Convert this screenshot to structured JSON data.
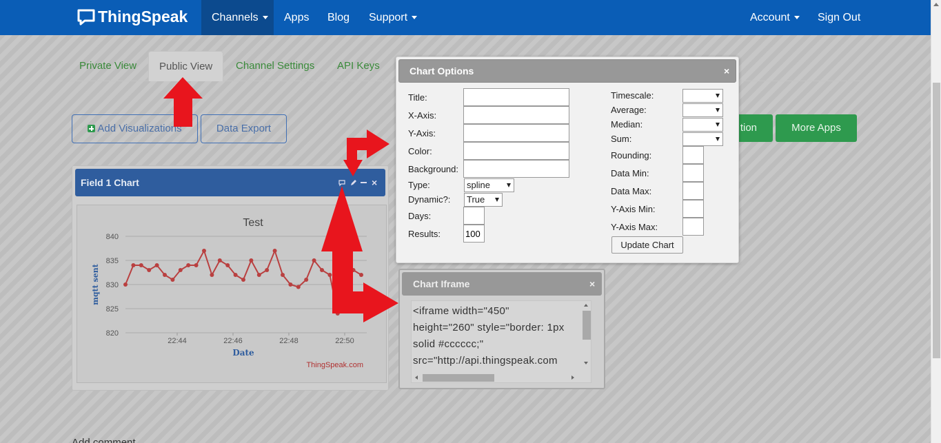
{
  "navbar": {
    "brand": "ThingSpeak",
    "items": [
      {
        "label": "Channels",
        "dropdown": true,
        "active": true
      },
      {
        "label": "Apps"
      },
      {
        "label": "Blog"
      },
      {
        "label": "Support",
        "dropdown": true
      }
    ],
    "right_items": [
      {
        "label": "Account",
        "dropdown": true
      },
      {
        "label": "Sign Out"
      }
    ],
    "bg_color": "#0a5db6"
  },
  "tabs": [
    {
      "label": "Private View"
    },
    {
      "label": "Public View",
      "active": true
    },
    {
      "label": "Channel Settings"
    },
    {
      "label": "API Keys"
    }
  ],
  "buttons": {
    "add_visualizations": "Add Visualizations",
    "data_export": "Data Export",
    "partial_app_button": "tion",
    "more_apps": "More Apps"
  },
  "field_chart": {
    "panel_title": "Field 1 Chart",
    "icons": [
      "comment-icon",
      "pencil-icon",
      "minimize-icon",
      "close-icon"
    ],
    "credit": "ThingSpeak.com"
  },
  "chart_data": {
    "type": "line",
    "title": "Test",
    "xlabel": "Date",
    "ylabel": "mqtt sent",
    "y_ticks": [
      "840",
      "835",
      "830",
      "825",
      "820"
    ],
    "x_ticks": [
      "22:44",
      "22:46",
      "22:48",
      "22:50"
    ],
    "ylim": [
      820,
      840
    ],
    "series_color": "#b94040",
    "series": [
      {
        "values": [
          830,
          834,
          834,
          833,
          834,
          832,
          831,
          833,
          834,
          834,
          837,
          832,
          835,
          834,
          832,
          831,
          835,
          832,
          833,
          837,
          832,
          830,
          829.5,
          831,
          835,
          833,
          832,
          824,
          833,
          833,
          832
        ]
      }
    ]
  },
  "chart_options": {
    "title": "Chart Options",
    "left_fields": [
      {
        "label": "Title:",
        "value": ""
      },
      {
        "label": "X-Axis:",
        "value": ""
      },
      {
        "label": "Y-Axis:",
        "value": ""
      },
      {
        "label": "Color:",
        "value": ""
      },
      {
        "label": "Background:",
        "value": ""
      }
    ],
    "type_label": "Type:",
    "type_value": "spline",
    "dynamic_label": "Dynamic?:",
    "dynamic_value": "True",
    "days_label": "Days:",
    "days_value": "",
    "results_label": "Results:",
    "results_value": "100",
    "right_selects": [
      {
        "label": "Timescale:",
        "value": ""
      },
      {
        "label": "Average:",
        "value": ""
      },
      {
        "label": "Median:",
        "value": ""
      },
      {
        "label": "Sum:",
        "value": ""
      }
    ],
    "right_fields": [
      {
        "label": "Rounding:",
        "value": ""
      },
      {
        "label": "Data Min:",
        "value": ""
      },
      {
        "label": "Data Max:",
        "value": ""
      },
      {
        "label": "Y-Axis Min:",
        "value": ""
      },
      {
        "label": "Y-Axis Max:",
        "value": ""
      }
    ],
    "update_button": "Update Chart"
  },
  "chart_iframe": {
    "title": "Chart Iframe",
    "code_lines": [
      "<iframe width=\"450\"",
      "height=\"260\" style=\"border: 1px",
      "solid #cccccc;\"",
      "src=\"http://api.thingspeak.com"
    ]
  },
  "footer": {
    "partial_text": "Add comment"
  }
}
